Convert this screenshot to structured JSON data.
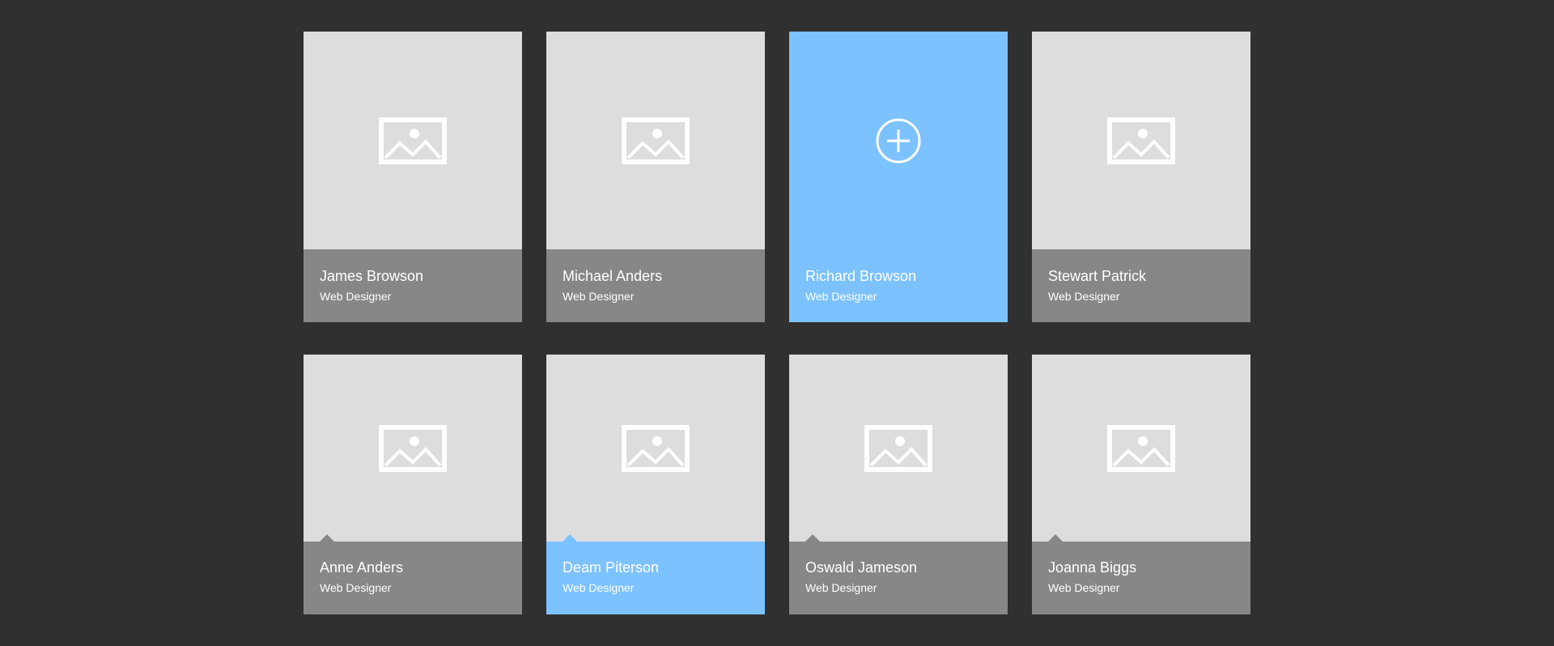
{
  "colors": {
    "background": "#303030",
    "thumbnail": "#dddddd",
    "info_panel": "#878787",
    "accent": "#7cc2ff",
    "text": "#ffffff"
  },
  "cards": [
    {
      "name": "James Browson",
      "role": "Web Designer",
      "icon": "image-placeholder-icon",
      "active": false
    },
    {
      "name": "Michael Anders",
      "role": "Web Designer",
      "icon": "image-placeholder-icon",
      "active": false
    },
    {
      "name": "Richard Browson",
      "role": "Web Designer",
      "icon": "add-circle-icon",
      "active": true
    },
    {
      "name": "Stewart Patrick",
      "role": "Web Designer",
      "icon": "image-placeholder-icon",
      "active": false
    },
    {
      "name": "Anne Anders",
      "role": "Web Designer",
      "icon": "image-placeholder-icon",
      "active": false
    },
    {
      "name": "Deam Piterson",
      "role": "Web Designer",
      "icon": "image-placeholder-icon",
      "active": true
    },
    {
      "name": "Oswald Jameson",
      "role": "Web Designer",
      "icon": "image-placeholder-icon",
      "active": false
    },
    {
      "name": "Joanna Biggs",
      "role": "Web Designer",
      "icon": "image-placeholder-icon",
      "active": false
    }
  ]
}
